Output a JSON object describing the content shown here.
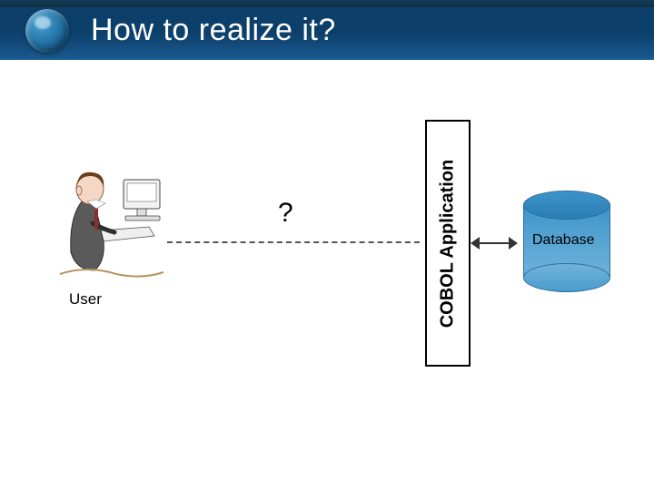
{
  "slide": {
    "title": "How to realize it?",
    "user_label": "User",
    "question": "?",
    "cobol_box_label": "COBOL Application",
    "database_label": "Database"
  }
}
